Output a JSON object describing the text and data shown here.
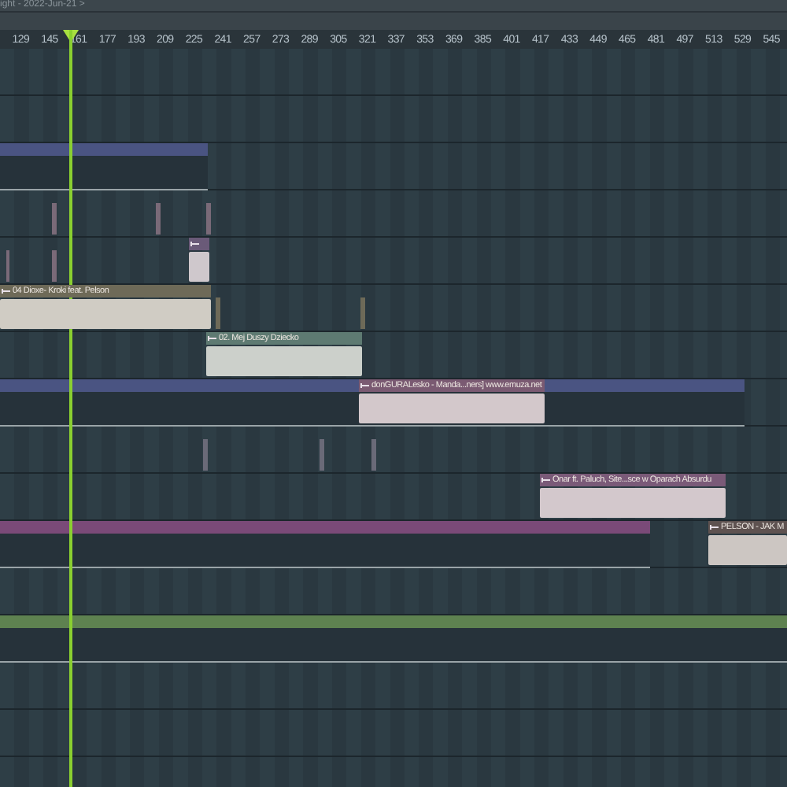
{
  "window": {
    "title": "ight - 2022-Jun-21 >"
  },
  "ruler": {
    "labels": [
      "129",
      "145",
      "161",
      "177",
      "193",
      "209",
      "225",
      "241",
      "257",
      "273",
      "289",
      "305",
      "321",
      "337",
      "353",
      "369",
      "385",
      "401",
      "417",
      "433",
      "449",
      "465",
      "481",
      "497",
      "513",
      "529",
      "545"
    ]
  },
  "tracks": [
    {
      "clips": [
        {
          "kind": "pattern",
          "color": "#4a5482"
        }
      ]
    },
    {
      "clips": [
        {
          "kind": "sliver",
          "color": "#7a6a78"
        },
        {
          "kind": "sliver",
          "color": "#7a6a78"
        },
        {
          "kind": "sliver",
          "color": "#7a6a78"
        }
      ]
    },
    {
      "clips": [
        {
          "kind": "sliver",
          "color": "#7a6a78"
        },
        {
          "kind": "sliver",
          "color": "#7a6a78"
        },
        {
          "kind": "audio",
          "color": "#6a5a78"
        }
      ]
    },
    {
      "clips": [
        {
          "kind": "audio",
          "label": "04 Dioxe- Kroki feat. Pelson",
          "color": "#6e6a58"
        },
        {
          "kind": "sliver",
          "color": "#6e6a58"
        },
        {
          "kind": "sliver",
          "color": "#6e6a58"
        }
      ]
    },
    {
      "clips": [
        {
          "kind": "audio",
          "label": "02. Mej Duszy Dziecko",
          "color": "#5e7a72"
        }
      ]
    },
    {
      "clips": [
        {
          "kind": "pattern",
          "color": "#4a5482"
        },
        {
          "kind": "audio",
          "label": "donGURALesko - Manda...ners] www.emuza.net",
          "color": "#7a5a72"
        }
      ]
    },
    {
      "clips": [
        {
          "kind": "sliver",
          "color": "#6a6a78"
        },
        {
          "kind": "sliver",
          "color": "#6a6a78"
        },
        {
          "kind": "sliver",
          "color": "#6a6a78"
        }
      ]
    },
    {
      "clips": [
        {
          "kind": "audio",
          "label": "Onar ft. Paluch, Site...sce w Oparach Absurdu",
          "color": "#7a5a78"
        }
      ]
    },
    {
      "clips": [
        {
          "kind": "pattern",
          "color": "#7a4a78"
        },
        {
          "kind": "audio",
          "label": "PELSON - JAK M",
          "color": "#5e5250"
        }
      ]
    },
    {
      "clips": [
        {
          "kind": "pattern",
          "color": "#5e8250"
        }
      ]
    }
  ]
}
